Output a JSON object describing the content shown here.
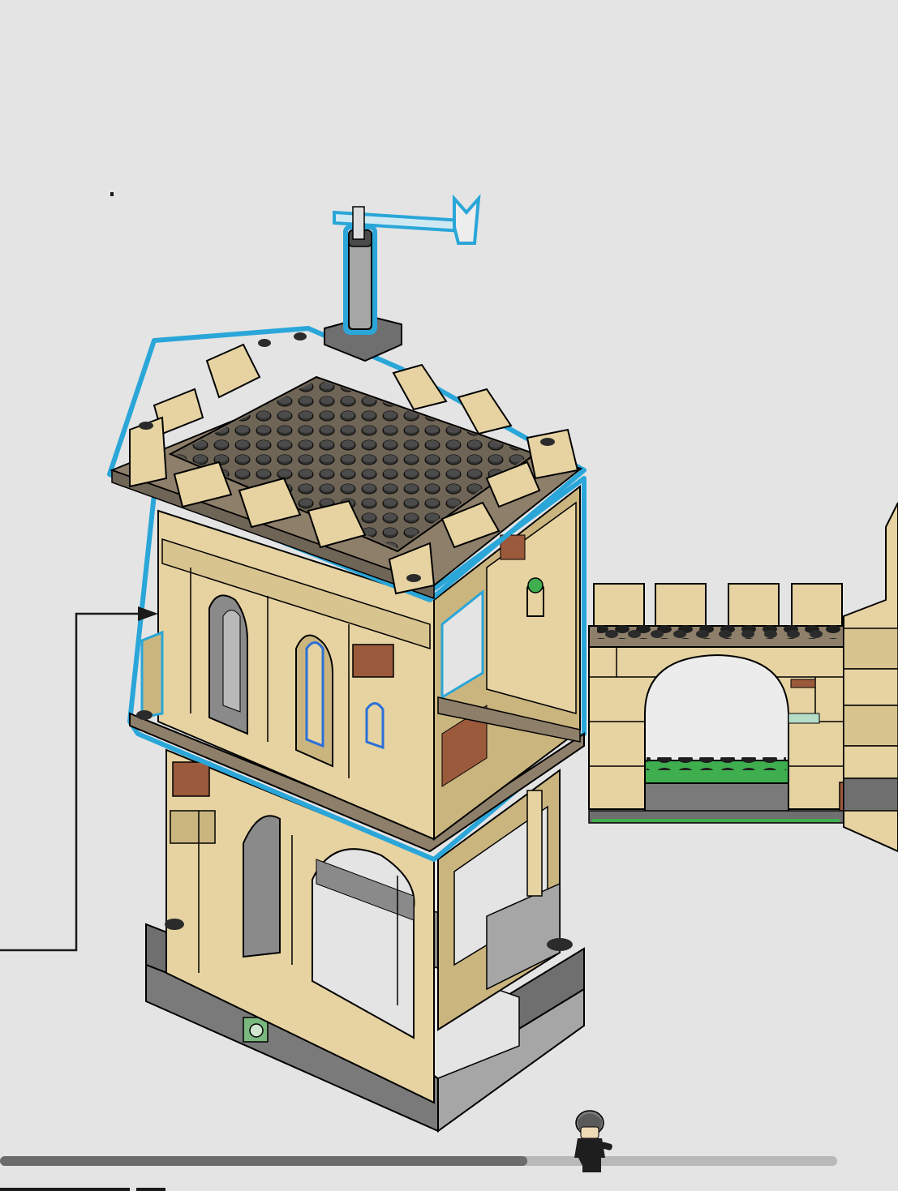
{
  "page": {
    "background": "#e4e4e4"
  },
  "colors": {
    "tan": "#e6d3a1",
    "tan_dark": "#cbb57f",
    "tan_shadow": "#b9a36e",
    "dark_tan_plate": "#8e7f6a",
    "stud_dark": "#2b2b2b",
    "dark_gray": "#6f6f6f",
    "light_gray": "#a6a6a6",
    "reddish_brown": "#9b5a3c",
    "green": "#3fae4f",
    "highlight_outline": "#2aa6d8",
    "pole_gray": "#8a8a8a",
    "trans_clear": "#cfe9f3",
    "arrow": "#1a1a1a",
    "progress_track": "#b9b9b9",
    "progress_fill": "#6c6c6c"
  },
  "progress": {
    "fraction": 0.63
  },
  "icons": {
    "callout_arrow": "callout-arrow-icon",
    "minifigure": "minifigure-progress-icon"
  }
}
